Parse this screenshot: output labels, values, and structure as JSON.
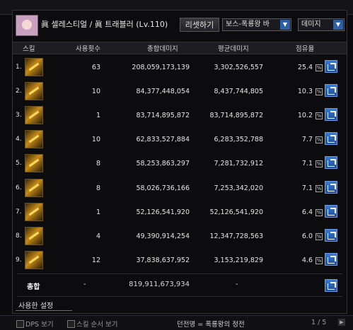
{
  "header": {
    "title": "眞 셀레스티얼 / 眞 트래블러 (Lv.110)",
    "reset_label": "리셋하기",
    "boss_select": "보스-폭룡왕 바",
    "metric_select": "데미지"
  },
  "table": {
    "columns": [
      "스킬",
      "사용횟수",
      "총합데미지",
      "평균데미지",
      "점유율"
    ],
    "rows": [
      {
        "idx": "1.",
        "uses": "63",
        "total": "208,059,173,139",
        "avg": "3,302,526,557",
        "pct": "25.4"
      },
      {
        "idx": "2.",
        "uses": "10",
        "total": "84,377,448,054",
        "avg": "8,437,744,805",
        "pct": "10.3"
      },
      {
        "idx": "3.",
        "uses": "1",
        "total": "83,714,895,872",
        "avg": "83,714,895,872",
        "pct": "10.2"
      },
      {
        "idx": "4.",
        "uses": "10",
        "total": "62,833,527,884",
        "avg": "6,283,352,788",
        "pct": "7.7"
      },
      {
        "idx": "5.",
        "uses": "8",
        "total": "58,253,863,297",
        "avg": "7,281,732,912",
        "pct": "7.1"
      },
      {
        "idx": "6.",
        "uses": "8",
        "total": "58,026,736,166",
        "avg": "7,253,342,020",
        "pct": "7.1"
      },
      {
        "idx": "7.",
        "uses": "1",
        "total": "52,126,541,920",
        "avg": "52,126,541,920",
        "pct": "6.4"
      },
      {
        "idx": "8.",
        "uses": "4",
        "total": "49,390,914,254",
        "avg": "12,347,728,563",
        "pct": "6.0"
      },
      {
        "idx": "9.",
        "uses": "12",
        "total": "37,838,637,952",
        "avg": "3,153,219,829",
        "pct": "4.6"
      }
    ],
    "pct_unit": "%"
  },
  "summary": {
    "label": "총합",
    "dash": "-",
    "total": "819,911,673,934"
  },
  "footer": {
    "settings_label": "사용한 설정",
    "dps_label": "DPS 보기",
    "skill_order_label": "스킬 순서 보기",
    "dungeon_label": "던전명 = 폭룡왕의 정전",
    "pager": "1 / 5"
  },
  "icons": [
    "skill-icon",
    "share-icon",
    "chevron-down-icon",
    "percent-icon"
  ],
  "colors": {
    "accent": "#2b5fa6",
    "share": "#3a78d0",
    "icon_gold": "#c58a18"
  }
}
